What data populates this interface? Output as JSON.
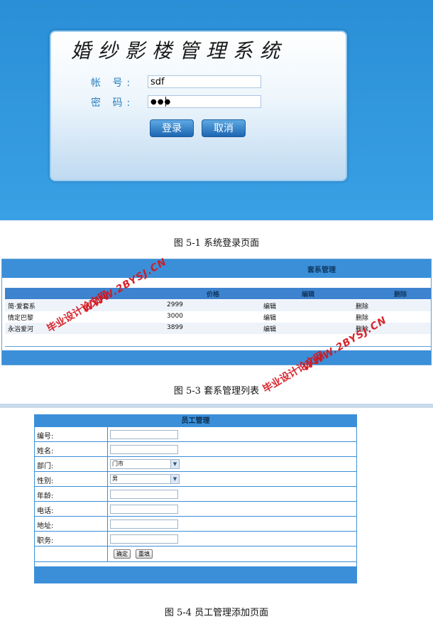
{
  "login": {
    "title": "婚纱影楼管理系统",
    "account_label": "帐 号:",
    "account_value": "sdf",
    "password_label": "密 码:",
    "password_value": "●●●",
    "login_button": "登录",
    "cancel_button": "取消"
  },
  "captions": {
    "fig1": "图 5-1 系统登录页面",
    "fig3": "图 5-3 套系管理列表",
    "fig4": "图 5-4 员工管理添加页面"
  },
  "package_list": {
    "title": "套系管理",
    "columns": [
      "价格",
      "编辑",
      "删除"
    ],
    "rows": [
      {
        "name": "简·爱套系",
        "price": "2999",
        "edit": "编辑",
        "delete": "删除"
      },
      {
        "name": "情定巴黎",
        "price": "3000",
        "edit": "编辑",
        "delete": "删除"
      },
      {
        "name": "永浴爱河",
        "price": "3899",
        "edit": "编辑",
        "delete": "删除"
      }
    ]
  },
  "employee_form": {
    "title": "员工管理",
    "fields": {
      "id": "编号:",
      "name": "姓名:",
      "department": "部门:",
      "gender": "性别:",
      "age": "年龄:",
      "phone": "电话:",
      "address": "地址:",
      "position": "职务:"
    },
    "department_value": "门市",
    "gender_value": "男",
    "confirm_button": "确定",
    "reset_button": "重填"
  },
  "watermarks": {
    "url": "WWW.2BYSJ.CN",
    "site": "毕业设计论文网"
  },
  "colors": {
    "header_blue": "#3b8fd9",
    "watermark_red": "#d6141c"
  }
}
